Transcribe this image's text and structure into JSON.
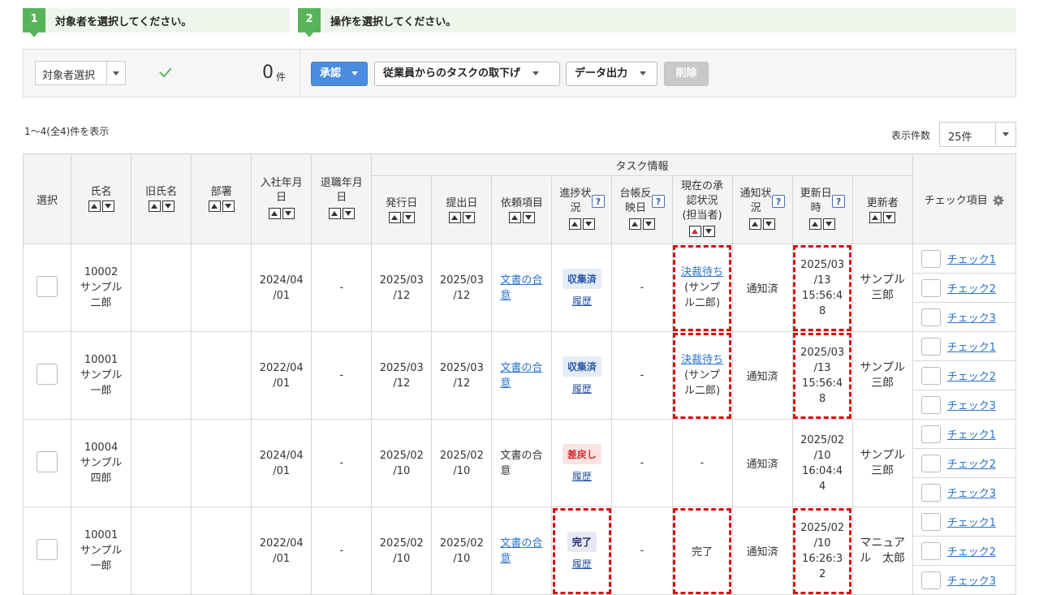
{
  "steps": [
    {
      "num": "1",
      "text": "対象者を選択してください。"
    },
    {
      "num": "2",
      "text": "操作を選択してください。"
    }
  ],
  "toolbar": {
    "select_label": "対象者選択",
    "count": "0",
    "count_unit": "件",
    "approve": "承認",
    "withdraw": "従業員からのタスクの取下げ",
    "export": "データ出力",
    "delete": "削除"
  },
  "summary": "1〜4(全4)件を表示",
  "page_size": {
    "label": "表示件数",
    "value": "25件"
  },
  "headers": {
    "select": "選択",
    "name": "氏名",
    "old_name": "旧氏名",
    "dept": "部署",
    "join": "入社年月日",
    "leave": "退職年月日",
    "task_info": "タスク情報",
    "issue": "発行日",
    "submit": "提出日",
    "request": "依頼項目",
    "progress": "進捗状況",
    "ledger": "台帳反映日",
    "approval": "現在の承認状況 (担当者)",
    "notify": "通知状況",
    "updated": "更新日時",
    "updater": "更新者",
    "check_items": "チェック項目"
  },
  "rows": [
    {
      "id": "10002",
      "name1": "サンプル",
      "name2": "二郎",
      "join1": "2024/04",
      "join2": "/01",
      "leave": "-",
      "issue1": "2025/03",
      "issue2": "/12",
      "submit1": "2025/03",
      "submit2": "/12",
      "req1": "文書の合",
      "req2": "意",
      "status": "収集済",
      "history": "履歴",
      "ledger": "-",
      "appr_link": "決裁待ち",
      "appr1": "(サンプ",
      "appr2": "ル二郎)",
      "notify": "通知済",
      "up1": "2025/03",
      "up2": "/13",
      "up3": "15:56:4",
      "up4": "8",
      "by1": "サンプル",
      "by2": "三郎",
      "checks": [
        "チェック1",
        "チェック2",
        "チェック3"
      ]
    },
    {
      "id": "10001",
      "name1": "サンプル",
      "name2": "一郎",
      "join1": "2022/04",
      "join2": "/01",
      "leave": "-",
      "issue1": "2025/03",
      "issue2": "/12",
      "submit1": "2025/03",
      "submit2": "/12",
      "req1": "文書の合",
      "req2": "意",
      "status": "収集済",
      "history": "履歴",
      "ledger": "-",
      "appr_link": "決裁待ち",
      "appr1": "(サンプ",
      "appr2": "ル二郎)",
      "notify": "通知済",
      "up1": "2025/03",
      "up2": "/13",
      "up3": "15:56:4",
      "up4": "8",
      "by1": "サンプル",
      "by2": "三郎",
      "checks": [
        "チェック1",
        "チェック2",
        "チェック3"
      ]
    },
    {
      "id": "10004",
      "name1": "サンプル",
      "name2": "四郎",
      "join1": "2024/04",
      "join2": "/01",
      "leave": "-",
      "issue1": "2025/02",
      "issue2": "/10",
      "submit1": "2025/02",
      "submit2": "/10",
      "req1": "文書の合",
      "req2": "意",
      "status": "差戻し",
      "history": "履歴",
      "ledger": "-",
      "appr_text": "-",
      "notify": "通知済",
      "up1": "2025/02",
      "up2": "/10",
      "up3": "16:04:4",
      "up4": "4",
      "by1": "サンプル",
      "by2": "三郎",
      "checks": [
        "チェック1",
        "チェック2",
        "チェック3"
      ]
    },
    {
      "id": "10001",
      "name1": "サンプル",
      "name2": "一郎",
      "join1": "2022/04",
      "join2": "/01",
      "leave": "-",
      "issue1": "2025/02",
      "issue2": "/10",
      "submit1": "2025/02",
      "submit2": "/10",
      "req1": "文書の合",
      "req2": "意",
      "status": "完了",
      "history": "履歴",
      "ledger": "-",
      "appr_text": "完了",
      "notify": "通知済",
      "up1": "2025/02",
      "up2": "/10",
      "up3": "16:26:3",
      "up4": "2",
      "by1": "マニュア",
      "by2": "ル　太郎",
      "checks": [
        "チェック1",
        "チェック2",
        "チェック3"
      ]
    }
  ],
  "colors": {
    "step_green": "#57b45a",
    "primary": "#4a8de0",
    "link": "#2a73c8",
    "highlight": "#d40f14"
  }
}
